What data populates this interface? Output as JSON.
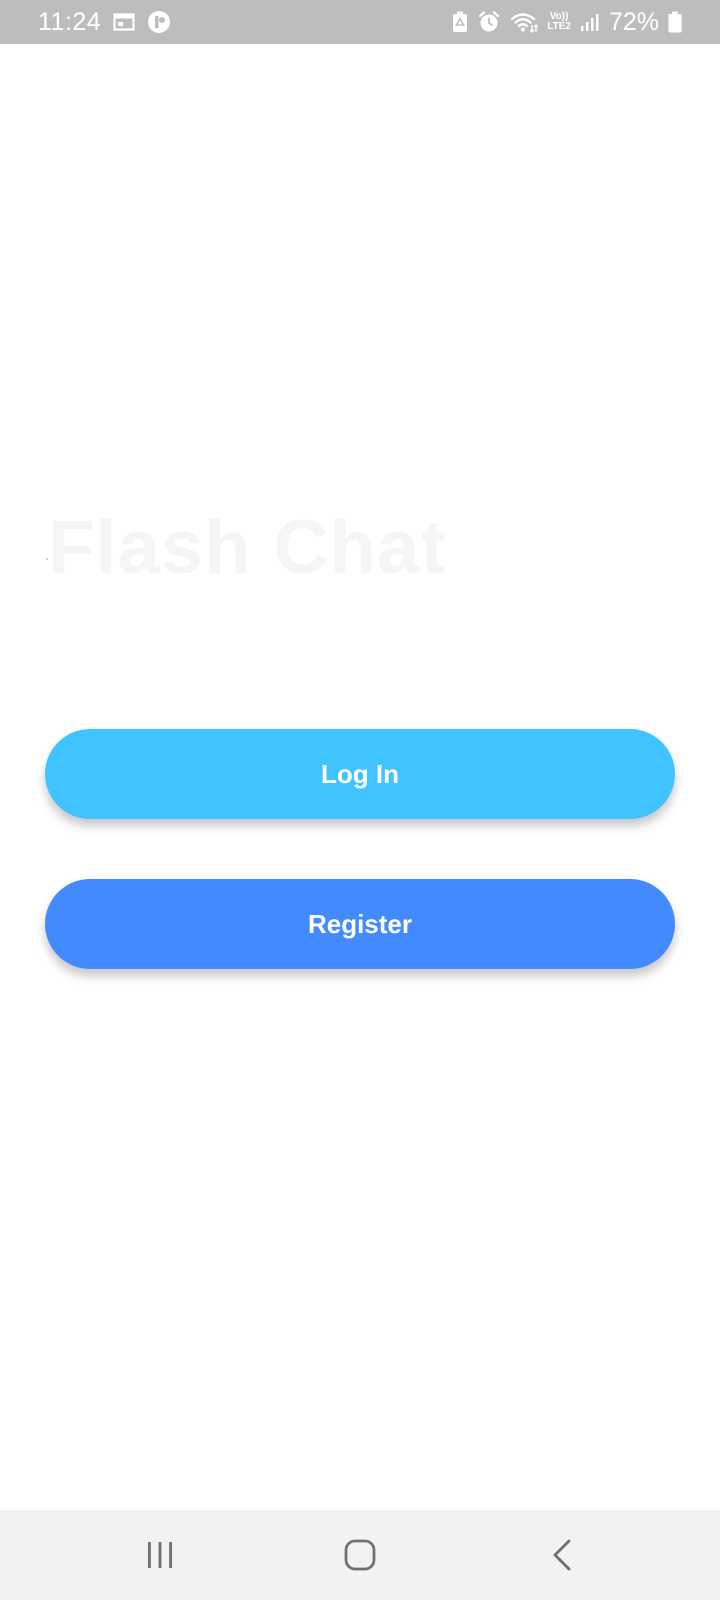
{
  "status_bar": {
    "time": "11:24",
    "battery_percent": "72%",
    "left_icons": [
      "calendar-icon",
      "app-notification-icon"
    ],
    "right_icons": [
      "battery-saver-icon",
      "alarm-icon",
      "wifi-icon",
      "volte-lte2-icon",
      "signal-icon",
      "battery-icon"
    ],
    "network_label_top": "Vo))",
    "network_label_bottom": "LTE2"
  },
  "main": {
    "title": "Flash Chat",
    "login_label": "Log In",
    "register_label": "Register"
  },
  "nav_bar": {
    "items": [
      "recents-icon",
      "home-icon",
      "back-icon"
    ]
  },
  "colors": {
    "status_bar_bg": "#bdbdbd",
    "login_button": "#40c4ff",
    "register_button": "#448aff",
    "nav_bar_bg": "#f2f2f2",
    "title_text": "#f5f5f5"
  }
}
